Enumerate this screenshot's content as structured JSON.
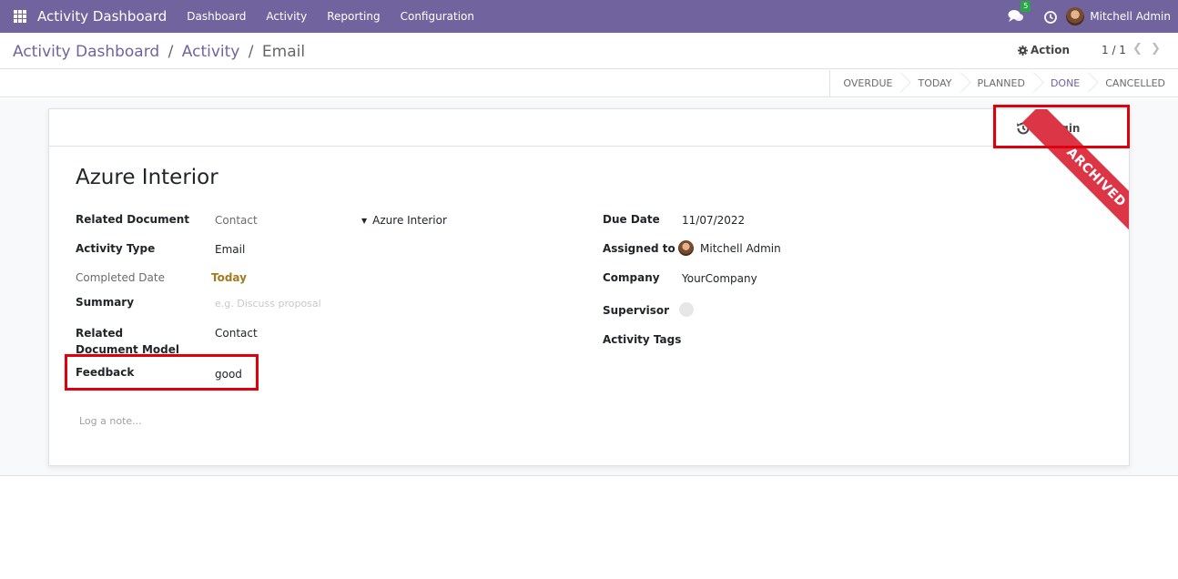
{
  "navbar": {
    "brand": "Activity Dashboard",
    "menu": [
      "Dashboard",
      "Activity",
      "Reporting",
      "Configuration"
    ],
    "messages_count": "5",
    "user_name": "Mitchell Admin"
  },
  "control_panel": {
    "breadcrumb": [
      "Activity Dashboard",
      "Activity",
      "Email"
    ],
    "action_label": "Action",
    "pager": "1 / 1"
  },
  "stages": [
    "OVERDUE",
    "TODAY",
    "PLANNED",
    "DONE",
    "CANCELLED"
  ],
  "active_stage": "DONE",
  "form": {
    "origin_button": "Origin",
    "ribbon": "ARCHIVED",
    "title": "Azure Interior",
    "left": {
      "related_document_label": "Related Document",
      "related_document_model_value": "Contact",
      "related_document_record": "Azure Interior",
      "activity_type_label": "Activity Type",
      "activity_type_value": "Email",
      "completed_date_label": "Completed Date",
      "completed_date_value": "Today",
      "summary_label": "Summary",
      "summary_placeholder": "e.g. Discuss proposal",
      "related_model_label": "Related Document Model",
      "related_model_value": "Contact",
      "feedback_label": "Feedback",
      "feedback_value": "good"
    },
    "right": {
      "due_date_label": "Due Date",
      "due_date_value": "11/07/2022",
      "assigned_to_label": "Assigned to",
      "assigned_to_value": "Mitchell Admin",
      "company_label": "Company",
      "company_value": "YourCompany",
      "supervisor_label": "Supervisor",
      "activity_tags_label": "Activity Tags"
    },
    "log_note": "Log a note..."
  },
  "colors": {
    "brand": "#71639e",
    "ribbon": "#dc3545",
    "highlight": "#e0000c"
  }
}
